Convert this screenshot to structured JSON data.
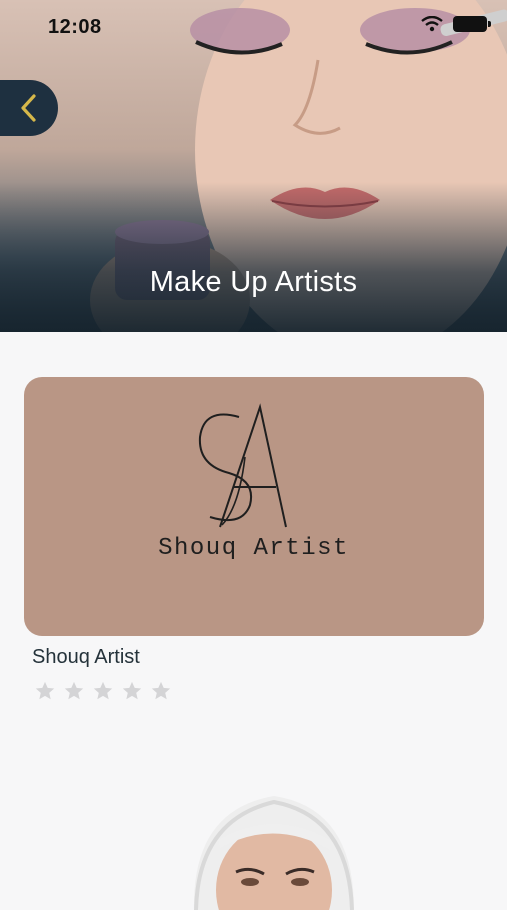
{
  "status_bar": {
    "time": "12:08"
  },
  "header": {
    "title": "Make Up Artists"
  },
  "artists": [
    {
      "name": "Shouq Artist",
      "logo_text": "Shouq Artist",
      "logo_monogram": "SA",
      "rating": 0,
      "max_rating": 5,
      "card_color": "#b99685"
    }
  ],
  "colors": {
    "back_button": "#1e3040",
    "back_chevron": "#d6b84a",
    "star_empty": "#d4d4d6"
  }
}
